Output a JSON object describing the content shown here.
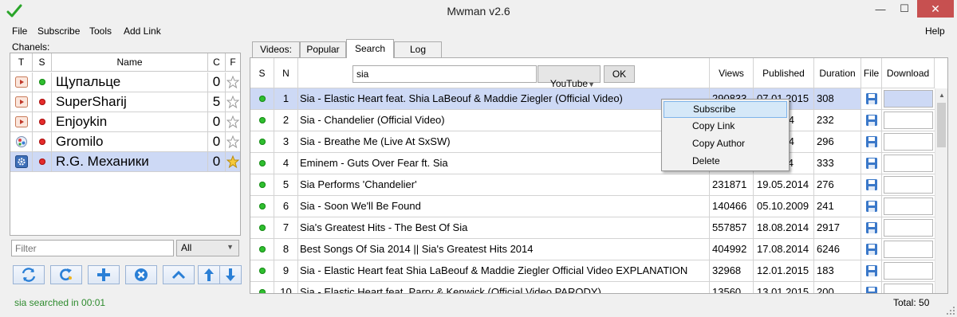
{
  "window": {
    "title": "Mwman v2.6",
    "min_glyph": "—",
    "max_glyph": "☐",
    "close_glyph": "✕"
  },
  "menu": {
    "file": "File",
    "subscribe": "Subscribe",
    "tools": "Tools",
    "add_link": "Add Link",
    "help": "Help"
  },
  "channels": {
    "caption": "Chanels:",
    "headers": {
      "t": "T",
      "s": "S",
      "name": "Name",
      "c": "C",
      "f": "F"
    },
    "rows": [
      {
        "name": "Щупальце",
        "count": "0",
        "status": "green",
        "type": "youtube-icon",
        "fav": false
      },
      {
        "name": "SuperSharij",
        "count": "5",
        "status": "red",
        "type": "youtube-icon",
        "fav": false
      },
      {
        "name": "Enjoykin",
        "count": "0",
        "status": "red",
        "type": "youtube-icon",
        "fav": false
      },
      {
        "name": "Gromilo",
        "count": "0",
        "status": "red",
        "type": "web-icon",
        "fav": false
      },
      {
        "name": "R.G. Механики",
        "count": "0",
        "status": "red",
        "type": "settings-icon",
        "fav": true
      }
    ],
    "filter_placeholder": "Filter",
    "filter_select": "All"
  },
  "tabs": {
    "videos": "Videos:",
    "popular": "Popular",
    "search": "Search",
    "log": "Log"
  },
  "grid": {
    "headers": {
      "s": "S",
      "n": "N",
      "views": "Views",
      "published": "Published",
      "duration": "Duration",
      "file": "File",
      "download": "Download"
    },
    "search_value": "sia",
    "source": "YouTube",
    "ok_label": "OK",
    "rows": [
      {
        "n": "1",
        "title": "Sia - Elastic Heart feat. Shia LaBeouf & Maddie Ziegler (Official Video)",
        "views": "290833",
        "published": "07.01.2015",
        "duration": "308"
      },
      {
        "n": "2",
        "title": "Sia - Chandelier (Official Video)",
        "views": "",
        "published": "05.2014",
        "duration": "232"
      },
      {
        "n": "3",
        "title": "Sia - Breathe Me (Live At SxSW)",
        "views": "",
        "published": "01.2014",
        "duration": "296"
      },
      {
        "n": "4",
        "title": "Eminem - Guts Over Fear ft. Sia",
        "views": "",
        "published": "11.2014",
        "duration": "333"
      },
      {
        "n": "5",
        "title": "Sia Performs 'Chandelier'",
        "views": "231871",
        "published": "19.05.2014",
        "duration": "276"
      },
      {
        "n": "6",
        "title": "Sia - Soon We'll Be Found",
        "views": "140466",
        "published": "05.10.2009",
        "duration": "241"
      },
      {
        "n": "7",
        "title": "Sia's Greatest Hits - The Best Of Sia",
        "views": "557857",
        "published": "18.08.2014",
        "duration": "2917"
      },
      {
        "n": "8",
        "title": "Best Songs Of Sia 2014 || Sia's Greatest Hits 2014",
        "views": "404992",
        "published": "17.08.2014",
        "duration": "6246"
      },
      {
        "n": "9",
        "title": "Sia - Elastic Heart feat  Shia LaBeouf & Maddie Ziegler Official Video EXPLANATION",
        "views": "32968",
        "published": "12.01.2015",
        "duration": "183"
      },
      {
        "n": "10",
        "title": "Sia - Elastic Heart feat. Parry & Kenwick (Official Video PARODY)",
        "views": "13560",
        "published": "13.01.2015",
        "duration": "200"
      }
    ]
  },
  "context_menu": {
    "subscribe": "Subscribe",
    "copy_link": "Copy Link",
    "copy_author": "Copy Author",
    "delete": "Delete"
  },
  "status": {
    "left": "sia searched in 00:01",
    "right": "Total: 50"
  },
  "colors": {
    "selection": "#cdd9f5",
    "status_green": "#2e8b2e",
    "dot_green": "#2fbf2f",
    "dot_red": "#e52b2b",
    "toolbar_blue": "#2a7fd6"
  }
}
